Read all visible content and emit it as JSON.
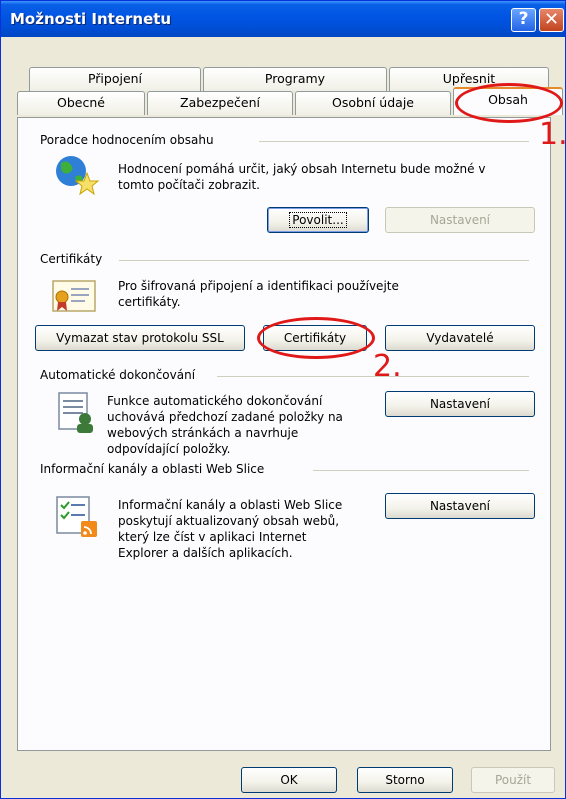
{
  "window": {
    "title": "Možnosti Internetu"
  },
  "titlebar": {
    "help_glyph": "?",
    "close_glyph": "✕"
  },
  "tabs": {
    "row_back": [
      "Připojení",
      "Programy",
      "Upřesnit"
    ],
    "row_front": [
      "Obecné",
      "Zabezpečení",
      "Osobní údaje",
      "Obsah"
    ],
    "active": "Obsah"
  },
  "content_advisor": {
    "heading": "Poradce hodnocením obsahu",
    "description_lines": [
      "Hodnocení pomáhá určit, jaký obsah Internetu bude možné v",
      "tomto počítači zobrazit."
    ],
    "enable_label": "Povolit...",
    "settings_label": "Nastavení"
  },
  "certificates": {
    "heading": "Certifikáty",
    "description_lines": [
      "Pro šifrovaná připojení a identifikaci používejte",
      "certifikáty."
    ],
    "clear_ssl_label": "Vymazat stav protokolu SSL",
    "certificates_label": "Certifikáty",
    "publishers_label": "Vydavatelé"
  },
  "autocomplete": {
    "heading": "Automatické dokončování",
    "description_lines": [
      "Funkce automatického dokončování",
      "uchovává předchozí zadané položky na",
      "webových stránkách a navrhuje",
      "odpovídající položky."
    ],
    "settings_label": "Nastavení"
  },
  "feeds": {
    "heading": "Informační kanály a oblasti Web Slice",
    "description_lines": [
      "Informační kanály a oblasti Web Slice",
      "poskytují aktualizovaný obsah webů,",
      "který lze číst v aplikaci Internet",
      "Explorer a dalších aplikacích."
    ],
    "settings_label": "Nastavení"
  },
  "footer": {
    "ok_label": "OK",
    "cancel_label": "Storno",
    "apply_label": "Použít"
  },
  "annotations": {
    "marker_1": "1.",
    "marker_2": "2."
  },
  "colors": {
    "titlebar": "#0054e3",
    "annotation_red": "#e01818",
    "dialog_bg": "#ece9d8"
  }
}
